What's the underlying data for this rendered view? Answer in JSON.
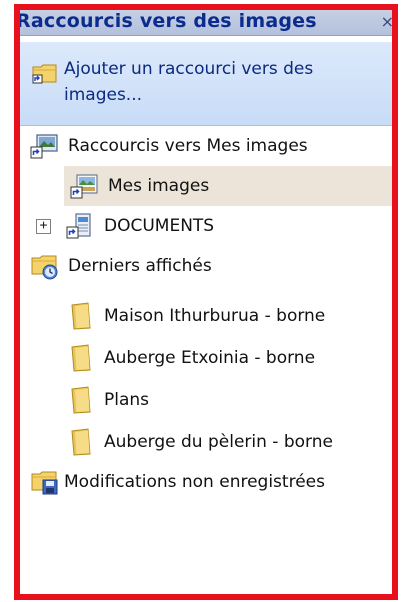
{
  "header": {
    "title": "Raccourcis vers des images",
    "close_glyph": "×"
  },
  "add_shortcut": {
    "label": "Ajouter un raccourci vers des images..."
  },
  "tree": {
    "root_shortcuts": {
      "label": "Raccourcis vers Mes images"
    },
    "mes_images": {
      "label": "Mes images",
      "selected": true
    },
    "documents": {
      "label": "DOCUMENTS",
      "expander": "+"
    },
    "recent": {
      "label": "Derniers affichés"
    },
    "recent_items": [
      {
        "label": "Maison Ithurburua - borne"
      },
      {
        "label": "Auberge Etxoinia - borne"
      },
      {
        "label": "Plans"
      },
      {
        "label": "Auberge du pèlerin - borne"
      }
    ],
    "unsaved": {
      "label": "Modifications non enregistrées"
    }
  },
  "colors": {
    "annotation_border": "#e8101c",
    "header_text": "#0b2c8e",
    "link_text": "#0b2a80",
    "selected_bg": "#ece4d8"
  }
}
